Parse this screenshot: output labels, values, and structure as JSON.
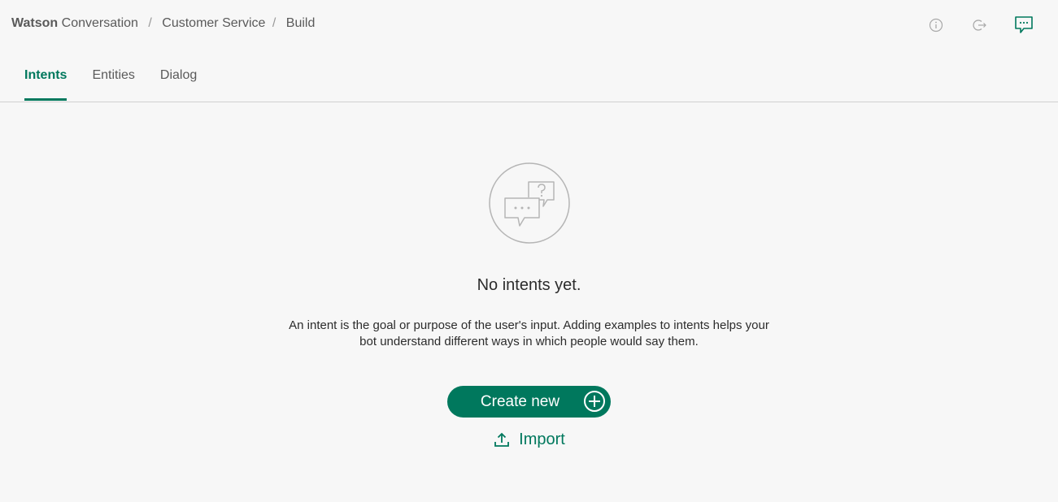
{
  "header": {
    "brand_bold": "Watson",
    "brand_rest": "Conversation",
    "breadcrumb_sep": "/",
    "workspace": "Customer Service",
    "page": "Build",
    "icons": [
      "info-icon",
      "logout-icon",
      "chat-icon"
    ]
  },
  "tabs": [
    {
      "label": "Intents",
      "active": true
    },
    {
      "label": "Entities",
      "active": false
    },
    {
      "label": "Dialog",
      "active": false
    }
  ],
  "empty": {
    "icon": "chat-question-icon",
    "title": "No intents yet.",
    "description_line1": "An intent is the goal or purpose of the user's input. Adding examples to intents helps your",
    "description_line2": "bot understand different ways in which people would say them."
  },
  "actions": {
    "create_label": "Create new",
    "import_label": "Import"
  },
  "colors": {
    "accent": "#00785d",
    "background": "#f7f7f7",
    "divider": "#d0d0d0"
  }
}
